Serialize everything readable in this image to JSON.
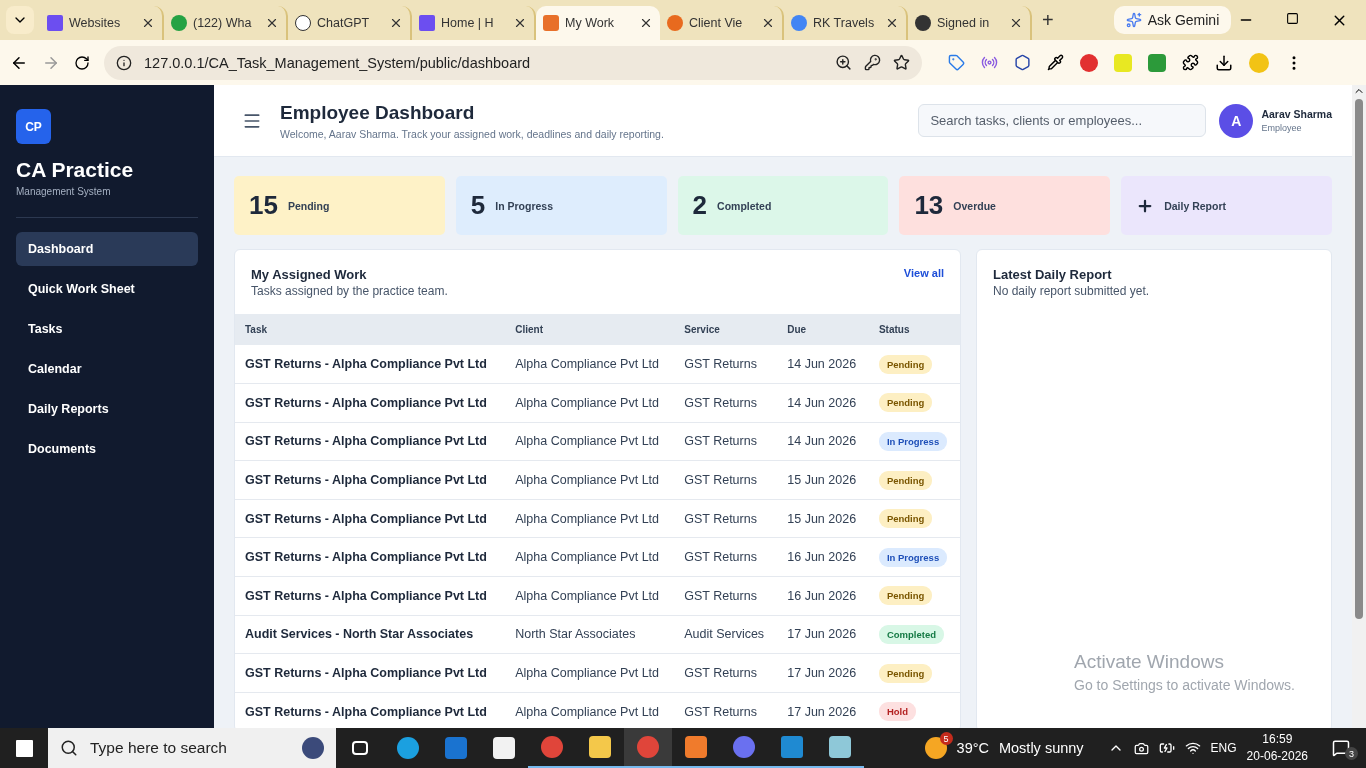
{
  "browser": {
    "tabs": [
      {
        "title": "Websites",
        "selected": false
      },
      {
        "title": "(122) Wha",
        "selected": false
      },
      {
        "title": "ChatGPT",
        "selected": false
      },
      {
        "title": "Home | H",
        "selected": false
      },
      {
        "title": "My Work",
        "selected": true
      },
      {
        "title": "Client Vie",
        "selected": false
      },
      {
        "title": "RK Travels",
        "selected": false
      },
      {
        "title": "Signed in",
        "selected": false
      }
    ],
    "new_tab": "+",
    "gemini": "Ask Gemini",
    "url": "127.0.0.1/CA_Task_Management_System/public/dashboard"
  },
  "sidebar": {
    "logo": "CP",
    "title": "CA Practice",
    "subtitle": "Management System",
    "items": [
      {
        "label": "Dashboard",
        "selected": true
      },
      {
        "label": "Quick Work Sheet",
        "selected": false
      },
      {
        "label": "Tasks",
        "selected": false
      },
      {
        "label": "Calendar",
        "selected": false
      },
      {
        "label": "Daily Reports",
        "selected": false
      },
      {
        "label": "Documents",
        "selected": false
      }
    ]
  },
  "header": {
    "title": "Employee Dashboard",
    "welcome": "Welcome, Aarav Sharma. Track your assigned work, deadlines and daily reporting.",
    "search_placeholder": "Search tasks, clients or employees...",
    "user": {
      "initial": "A",
      "name": "Aarav Sharma",
      "role": "Employee"
    }
  },
  "stats": [
    {
      "value": "15",
      "label": "Pending",
      "kind": "pending"
    },
    {
      "value": "5",
      "label": "In Progress",
      "kind": "progress"
    },
    {
      "value": "2",
      "label": "Completed",
      "kind": "completed"
    },
    {
      "value": "13",
      "label": "Overdue",
      "kind": "overdue"
    }
  ],
  "action_card": {
    "label": "Daily Report"
  },
  "assigned_work": {
    "title": "My Assigned Work",
    "subtitle": "Tasks assigned by the practice team.",
    "view_all": "View all",
    "columns": [
      "Task",
      "Client",
      "Service",
      "Due",
      "Status"
    ],
    "rows": [
      {
        "task": "GST Returns - Alpha Compliance Pvt Ltd",
        "client": "Alpha Compliance Pvt Ltd",
        "service": "GST Returns",
        "due": "14 Jun 2026",
        "status": {
          "label": "Pending",
          "kind": "pending"
        }
      },
      {
        "task": "GST Returns - Alpha Compliance Pvt Ltd",
        "client": "Alpha Compliance Pvt Ltd",
        "service": "GST Returns",
        "due": "14 Jun 2026",
        "status": {
          "label": "Pending",
          "kind": "pending"
        }
      },
      {
        "task": "GST Returns - Alpha Compliance Pvt Ltd",
        "client": "Alpha Compliance Pvt Ltd",
        "service": "GST Returns",
        "due": "14 Jun 2026",
        "status": {
          "label": "In Progress",
          "kind": "progress"
        }
      },
      {
        "task": "GST Returns - Alpha Compliance Pvt Ltd",
        "client": "Alpha Compliance Pvt Ltd",
        "service": "GST Returns",
        "due": "15 Jun 2026",
        "status": {
          "label": "Pending",
          "kind": "pending"
        }
      },
      {
        "task": "GST Returns - Alpha Compliance Pvt Ltd",
        "client": "Alpha Compliance Pvt Ltd",
        "service": "GST Returns",
        "due": "15 Jun 2026",
        "status": {
          "label": "Pending",
          "kind": "pending"
        }
      },
      {
        "task": "GST Returns - Alpha Compliance Pvt Ltd",
        "client": "Alpha Compliance Pvt Ltd",
        "service": "GST Returns",
        "due": "16 Jun 2026",
        "status": {
          "label": "In Progress",
          "kind": "progress"
        }
      },
      {
        "task": "GST Returns - Alpha Compliance Pvt Ltd",
        "client": "Alpha Compliance Pvt Ltd",
        "service": "GST Returns",
        "due": "16 Jun 2026",
        "status": {
          "label": "Pending",
          "kind": "pending"
        }
      },
      {
        "task": "Audit Services - North Star Associates",
        "client": "North Star Associates",
        "service": "Audit Services",
        "due": "17 Jun 2026",
        "status": {
          "label": "Completed",
          "kind": "completed"
        }
      },
      {
        "task": "GST Returns - Alpha Compliance Pvt Ltd",
        "client": "Alpha Compliance Pvt Ltd",
        "service": "GST Returns",
        "due": "17 Jun 2026",
        "status": {
          "label": "Pending",
          "kind": "pending"
        }
      },
      {
        "task": "GST Returns - Alpha Compliance Pvt Ltd",
        "client": "Alpha Compliance Pvt Ltd",
        "service": "GST Returns",
        "due": "17 Jun 2026",
        "status": {
          "label": "Hold",
          "kind": "hold"
        }
      }
    ]
  },
  "daily_report": {
    "title": "Latest Daily Report",
    "text": "No daily report submitted yet."
  },
  "activation": {
    "title": "Activate Windows",
    "text": "Go to Settings to activate Windows."
  },
  "taskbar": {
    "search_placeholder": "Type here to search",
    "weather_badge": "5",
    "temperature": "39°C",
    "condition": "Mostly sunny",
    "language": "ENG",
    "time": "16:59",
    "date": "20-06-2026",
    "notifications": "3"
  }
}
